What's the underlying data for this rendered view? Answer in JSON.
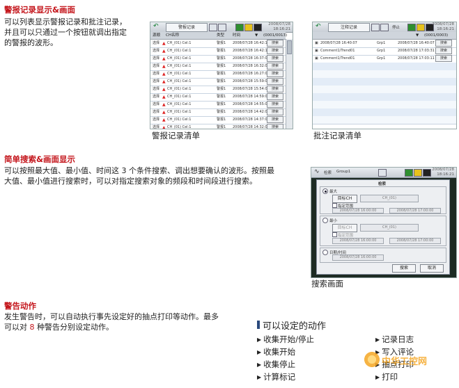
{
  "sections": {
    "list": {
      "title": "警报记录显示&画面",
      "body": "可以列表显示警报记录和批注记录，并且可以只通过一个按钮就调出指定的警报的波形。",
      "lines": [
        "可以列表显示警报记录和批注记录，",
        "并且可以只通过一个按钮就调出指定",
        "的警报的波形。"
      ]
    },
    "search": {
      "title": "简单搜索&画面显示",
      "lines": [
        "可以按照最大值、最小值、时间这 3 个条件搜索、调出想要确认的波形。按照最",
        "大值、最小值进行搜索时，可以对指定搜索对象的频段和时间段进行搜索。"
      ]
    },
    "alarm": {
      "title": "警告动作",
      "lines_a": [
        "发生警告时，可以自动执行事先设定好的抽点打印等动作。最多",
        "可以对 "
      ],
      "highlight": "8",
      "line_b_tail": " 种警告分别设定动作。"
    }
  },
  "captions": {
    "alarm_list": "警报记录清单",
    "note_list": "批注记录清单",
    "search_screen": "搜索画面"
  },
  "alarm_screen": {
    "title": "警报记录",
    "clock": [
      "2008/07/28",
      "18:16:21"
    ],
    "headers": [
      "源顺",
      "CH名称",
      "类型",
      "时间"
    ],
    "count": "(0001/0013)",
    "rows": [
      {
        "src": "选择",
        "ch": "CH_(01) Cel:1",
        "type": "警报1",
        "time": "2008/07/28 16:42:16",
        "btn": "搜索"
      },
      {
        "src": "选择",
        "ch": "CH_(01) Cel:1",
        "type": "警报1",
        "time": "2008/07/28 16:42:11",
        "btn": "搜索"
      },
      {
        "src": "选择",
        "ch": "CH_(01) Cel:1",
        "type": "警报1",
        "time": "2008/07/28 16:37:06",
        "btn": "搜索"
      },
      {
        "src": "选择",
        "ch": "CH_(01) Cel:1",
        "type": "警报1",
        "time": "2008/07/28 16:32:06",
        "btn": "搜索"
      },
      {
        "src": "选择",
        "ch": "CH_(01) Cel:1",
        "type": "警报1",
        "time": "2008/07/28 16:27:06",
        "btn": "搜索"
      },
      {
        "src": "选择",
        "ch": "CH_(01) Cel:1",
        "type": "警报1",
        "time": "2008/07/28 15:59:06",
        "btn": "搜索"
      },
      {
        "src": "选择",
        "ch": "CH_(01) Cel:1",
        "type": "警报1",
        "time": "2008/07/28 15:54:06",
        "btn": "搜索"
      },
      {
        "src": "选择",
        "ch": "CH_(01) Cel:1",
        "type": "警报1",
        "time": "2008/07/28 14:59:06",
        "btn": "搜索"
      },
      {
        "src": "选择",
        "ch": "CH_(01) Cel:1",
        "type": "警报1",
        "time": "2008/07/28 14:55:03",
        "btn": "搜索"
      },
      {
        "src": "选择",
        "ch": "CH_(01) Cel:1",
        "type": "警报1",
        "time": "2008/07/28 14:42:06",
        "btn": "搜索"
      },
      {
        "src": "选择",
        "ch": "CH_(01) Cel:1",
        "type": "警报1",
        "time": "2008/07/28 14:37:06",
        "btn": "搜索"
      },
      {
        "src": "选择",
        "ch": "CH_(01) Cel:1",
        "type": "警报1",
        "time": "2008/07/28 14:32:06",
        "btn": "搜索"
      }
    ]
  },
  "note_screen": {
    "title": "注释记录",
    "status": "停止",
    "clock": [
      "2008/07/28",
      "18:16:21"
    ],
    "count": "(0001/0003)",
    "rows": [
      {
        "name": "2008/07/28 16:40:07",
        "grp": "Grp1",
        "time": "2008/07/28 16:40:07",
        "btn": "搜索"
      },
      {
        "name": "Comment1/Trend01",
        "grp": "Grp1",
        "time": "2008/07/28 17:03:31",
        "btn": "搜索"
      },
      {
        "name": "Comment1/Trend01",
        "grp": "Grp1",
        "time": "2008/07/28 17:03:11",
        "btn": "搜索"
      }
    ]
  },
  "search_screen": {
    "title": "检索",
    "group": "Group1",
    "options": [
      "最大",
      "最小",
      "日期/时间"
    ],
    "target_btn": "目标CH",
    "target_val": "CH_(01)",
    "range_label": "指定范围",
    "time_from": "2008/07/28 16:00:00",
    "time_to": "2008/07/28 17:00:00",
    "search_btn": "搜索",
    "cancel_btn": "取消"
  },
  "actions": {
    "title": "可以设定的动作",
    "left": [
      "收集开始/停止",
      "收集开始",
      "收集停止",
      "计算标记"
    ],
    "right": [
      "记录日志",
      "写入评论",
      "抽点打印",
      "打印"
    ]
  },
  "watermark": "中华工控网",
  "colors": {
    "heading": "#c4161c",
    "accent_bar": "#2b4a7d",
    "watermark": "#f5a623"
  }
}
